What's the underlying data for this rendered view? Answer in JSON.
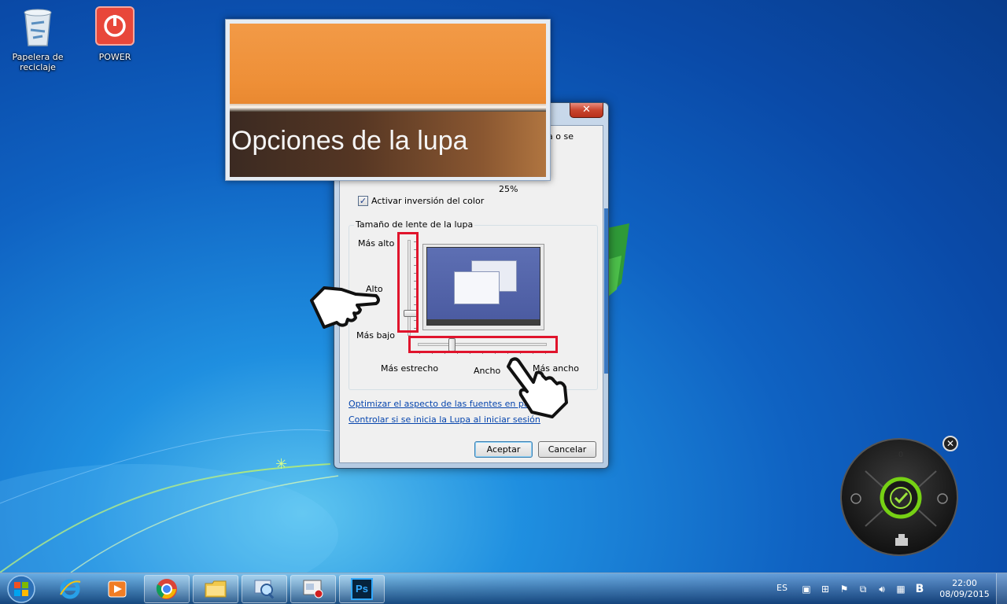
{
  "desktop": {
    "icons": [
      {
        "label": "Papelera de reciclaje"
      },
      {
        "label": "POWER"
      }
    ]
  },
  "magnifier": {
    "zoomed_text": "Opciones de la lupa"
  },
  "dialog": {
    "close_label": "✕",
    "fragment_top": "ía o se",
    "percent_label": "25%",
    "invert_color": {
      "label": "Activar inversión del color",
      "checked": true
    },
    "lens_group": {
      "legend": "Tamaño de lente de la lupa",
      "height_max": "Más alto",
      "height_label": "Alto",
      "height_min": "Más bajo",
      "width_min": "Más estrecho",
      "width_label": "Ancho",
      "width_max": "Más ancho"
    },
    "links": [
      "Optimizar el aspecto de las fuentes en pantalla",
      "Controlar si se inicia la Lupa al iniciar sesión"
    ],
    "ok_label": "Aceptar",
    "cancel_label": "Cancelar"
  },
  "taskbar": {
    "apps": [
      "internet-explorer",
      "media-player",
      "chrome",
      "file-explorer",
      "magnifier",
      "screen-recorder",
      "photoshop"
    ],
    "photoshop_label": "Ps",
    "language": "ES",
    "time": "22:00",
    "date": "08/09/2015"
  },
  "gadget": {
    "top_label": "0"
  },
  "colors": {
    "highlight_red": "#e0142c",
    "link_blue": "#0645ad",
    "magnifier_orange": "#ee8f37"
  }
}
